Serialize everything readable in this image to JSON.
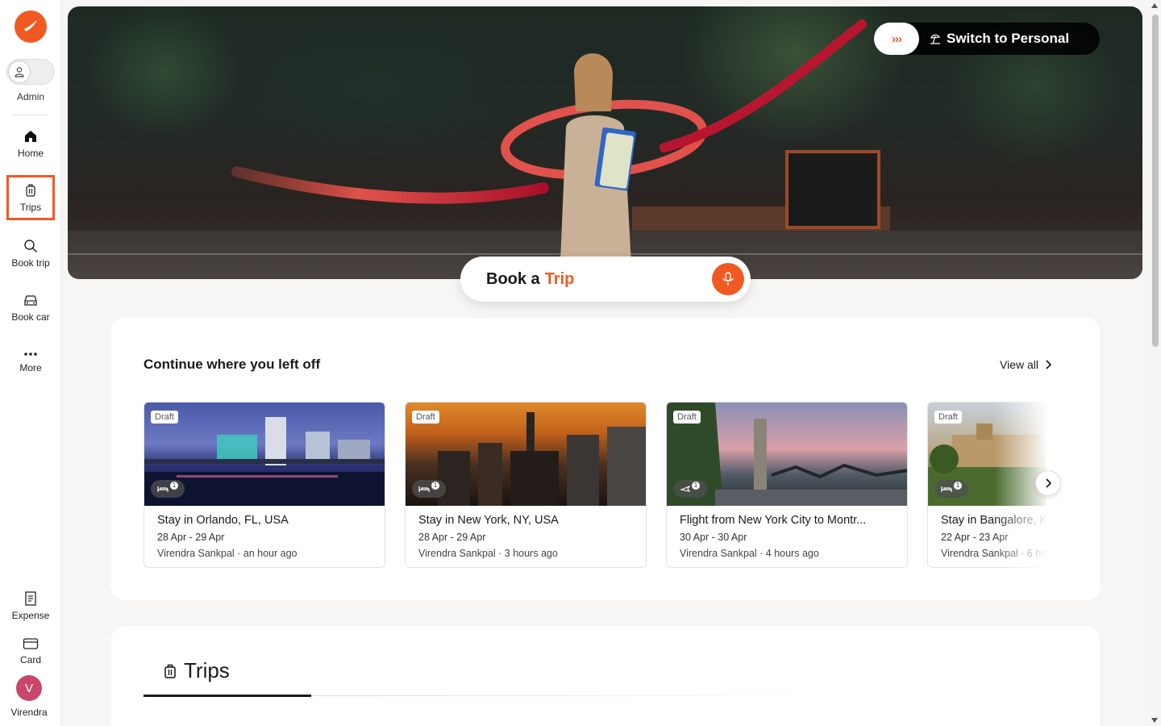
{
  "sidebar": {
    "logo_icon": "plane-logo-icon",
    "admin_label": "Admin",
    "nav": [
      {
        "label": "Home",
        "icon": "home-icon"
      },
      {
        "label": "Trips",
        "icon": "luggage-icon"
      },
      {
        "label": "Book trip",
        "icon": "search-icon"
      },
      {
        "label": "Book car",
        "icon": "car-icon"
      },
      {
        "label": "More",
        "icon": "more-icon"
      }
    ],
    "bottom": [
      {
        "label": "Expense",
        "icon": "receipt-icon"
      },
      {
        "label": "Card",
        "icon": "credit-card-icon"
      }
    ],
    "user": {
      "initial": "V",
      "name": "Virendra"
    }
  },
  "hero": {
    "switch_label": "Switch to Personal",
    "switch_arrows": "›››"
  },
  "book": {
    "prefix": "Book a",
    "accent": "Trip",
    "mic_icon": "microphone-icon"
  },
  "continue": {
    "title": "Continue where you left off",
    "view_all": "View all",
    "cards": [
      {
        "badge": "Draft",
        "type": "hotel",
        "count": "1",
        "title": "Stay in Orlando, FL, USA",
        "dates": "28 Apr - 29 Apr",
        "meta": "Virendra Sankpal · an hour ago"
      },
      {
        "badge": "Draft",
        "type": "hotel",
        "count": "1",
        "title": "Stay in New York, NY, USA",
        "dates": "28 Apr - 29 Apr",
        "meta": "Virendra Sankpal · 3 hours ago"
      },
      {
        "badge": "Draft",
        "type": "flight",
        "count": "1",
        "title": "Flight from New York City to Montr...",
        "dates": "30 Apr - 30 Apr",
        "meta": "Virendra Sankpal · 4 hours ago"
      },
      {
        "badge": "Draft",
        "type": "hotel",
        "count": "1",
        "title": "Stay in Bangalore, K",
        "dates": "22 Apr - 23 Apr",
        "meta": "Virendra Sankpal · 6 ho"
      }
    ]
  },
  "trips": {
    "title": "Trips"
  },
  "colors": {
    "accent": "#f05a22",
    "avatar": "#c9476a"
  }
}
